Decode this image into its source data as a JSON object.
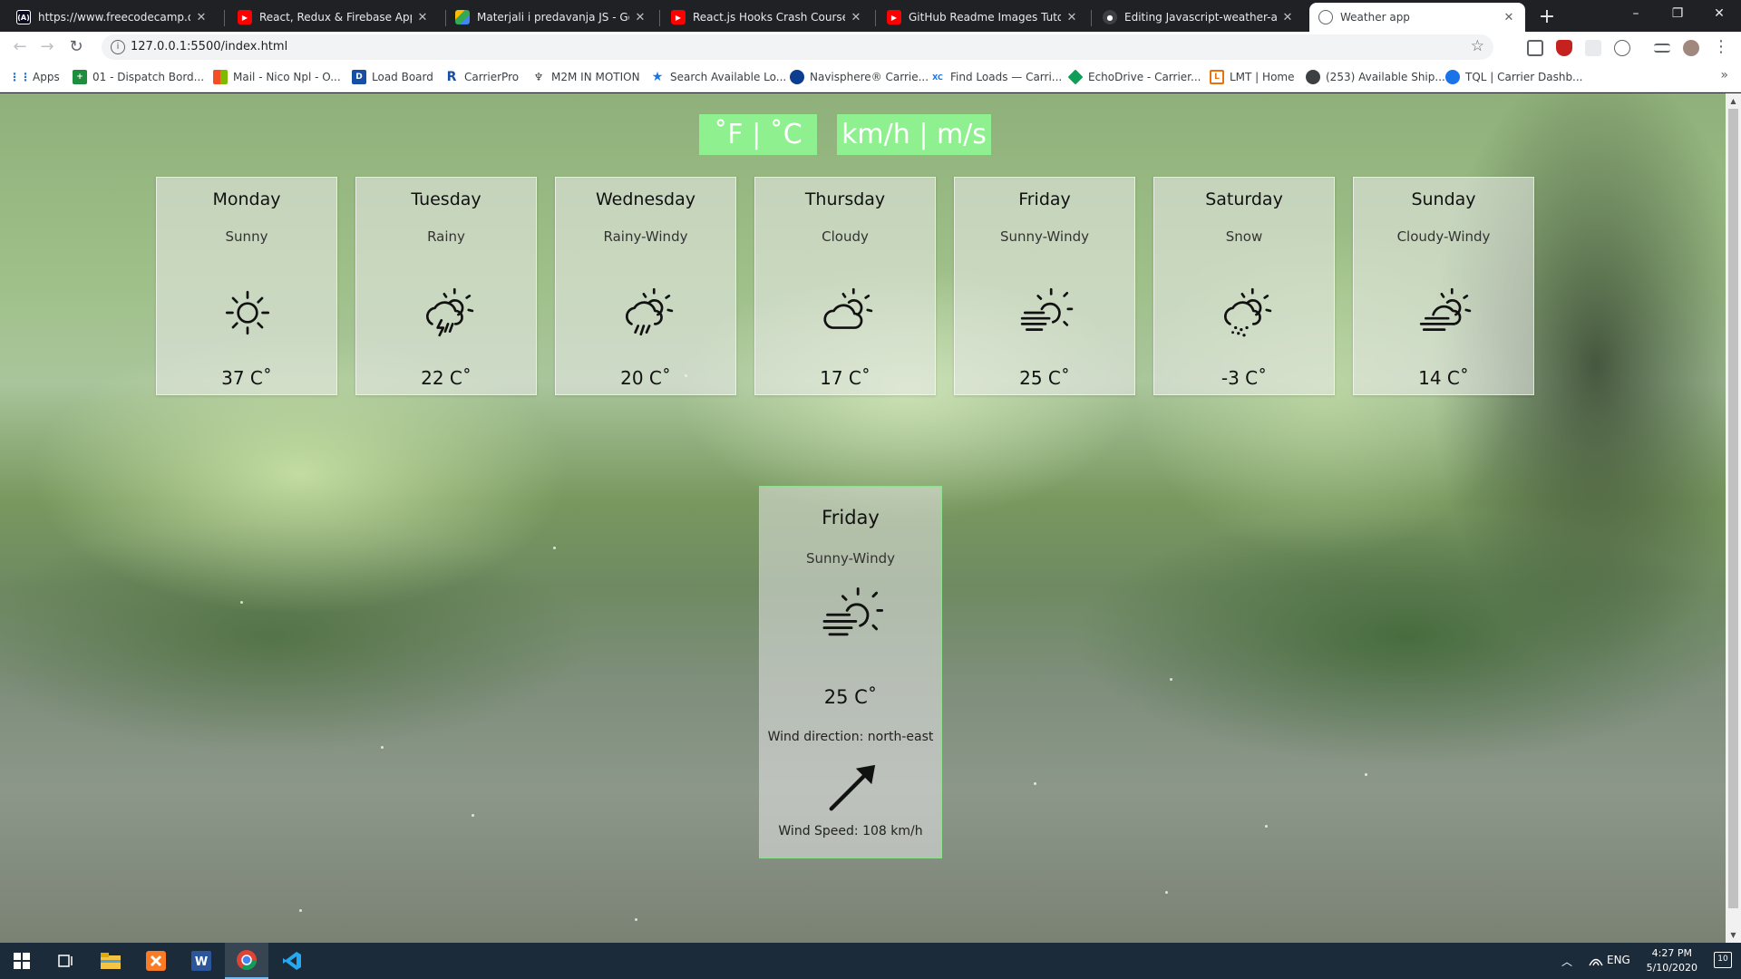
{
  "browser": {
    "tabs": [
      {
        "title": "https://www.freecodecamp.org/l",
        "favicon": "freecodecamp-icon",
        "active": false
      },
      {
        "title": "React, Redux & Firebase App Tut",
        "favicon": "youtube-icon",
        "active": false
      },
      {
        "title": "Materjali i predavanja JS - Googl",
        "favicon": "google-drive-icon",
        "active": false
      },
      {
        "title": "React.js Hooks Crash Course - Yo",
        "favicon": "youtube-icon",
        "active": false
      },
      {
        "title": "GitHub Readme Images Tutorial",
        "favicon": "youtube-icon",
        "active": false
      },
      {
        "title": "Editing Javascript-weather-app/R",
        "favicon": "github-icon",
        "active": false
      },
      {
        "title": "Weather app",
        "favicon": "globe-icon",
        "active": true
      }
    ],
    "url": "127.0.0.1:5500/index.html",
    "bookmarks": [
      {
        "label": "Apps",
        "icon": "apps-grid-icon"
      },
      {
        "label": "01 - Dispatch Bord...",
        "icon": "plus-square-icon"
      },
      {
        "label": "Mail - Nico Npl - O...",
        "icon": "microsoft-icon"
      },
      {
        "label": "Load Board",
        "icon": "d-logo-icon"
      },
      {
        "label": "CarrierPro",
        "icon": "r-logo-icon"
      },
      {
        "label": "M2M IN MOTION",
        "icon": "m2m-icon"
      },
      {
        "label": "Search Available Lo...",
        "icon": "star-logo-icon"
      },
      {
        "label": "Navisphere® Carrie...",
        "icon": "navisphere-icon"
      },
      {
        "label": "Find Loads — Carri...",
        "icon": "xc-logo-icon"
      },
      {
        "label": "EchoDrive - Carrier...",
        "icon": "echo-icon"
      },
      {
        "label": "LMT | Home",
        "icon": "lmt-icon"
      },
      {
        "label": "(253) Available Ship...",
        "icon": "shipping-icon"
      },
      {
        "label": "TQL | Carrier Dashb...",
        "icon": "tql-icon"
      }
    ]
  },
  "app": {
    "toggles": {
      "temperature": "˚F | ˚C",
      "speed": "km/h | m/s"
    },
    "days": [
      {
        "day": "Monday",
        "condition": "Sunny",
        "temp": "37 C˚",
        "icon": "sun-icon"
      },
      {
        "day": "Tuesday",
        "condition": "Rainy",
        "temp": "22 C˚",
        "icon": "thunderstorm-sun-icon"
      },
      {
        "day": "Wednesday",
        "condition": "Rainy-Windy",
        "temp": "20 C˚",
        "icon": "rain-sun-icon"
      },
      {
        "day": "Thursday",
        "condition": "Cloudy",
        "temp": "17 C˚",
        "icon": "cloud-sun-icon"
      },
      {
        "day": "Friday",
        "condition": "Sunny-Windy",
        "temp": "25 C˚",
        "icon": "wind-sun-icon"
      },
      {
        "day": "Saturday",
        "condition": "Snow",
        "temp": "-3 C˚",
        "icon": "snow-sun-icon"
      },
      {
        "day": "Sunday",
        "condition": "Cloudy-Windy",
        "temp": "14 C˚",
        "icon": "cloud-wind-sun-icon"
      }
    ],
    "detail": {
      "day": "Friday",
      "condition": "Sunny-Windy",
      "temp": "25 C˚",
      "wind_direction": "Wind direction: north-east",
      "wind_speed": "Wind Speed: 108 km/h",
      "icon": "wind-sun-icon",
      "arrow_icon": "arrow-north-east-icon"
    },
    "colors": {
      "toggle_bg": "#8ff08f",
      "toggle_text": "#ffffff",
      "detail_border": "#8fe08f"
    }
  },
  "taskbar": {
    "language": "ENG",
    "time": "4:27 PM",
    "date": "5/10/2020",
    "notifications": "10"
  }
}
